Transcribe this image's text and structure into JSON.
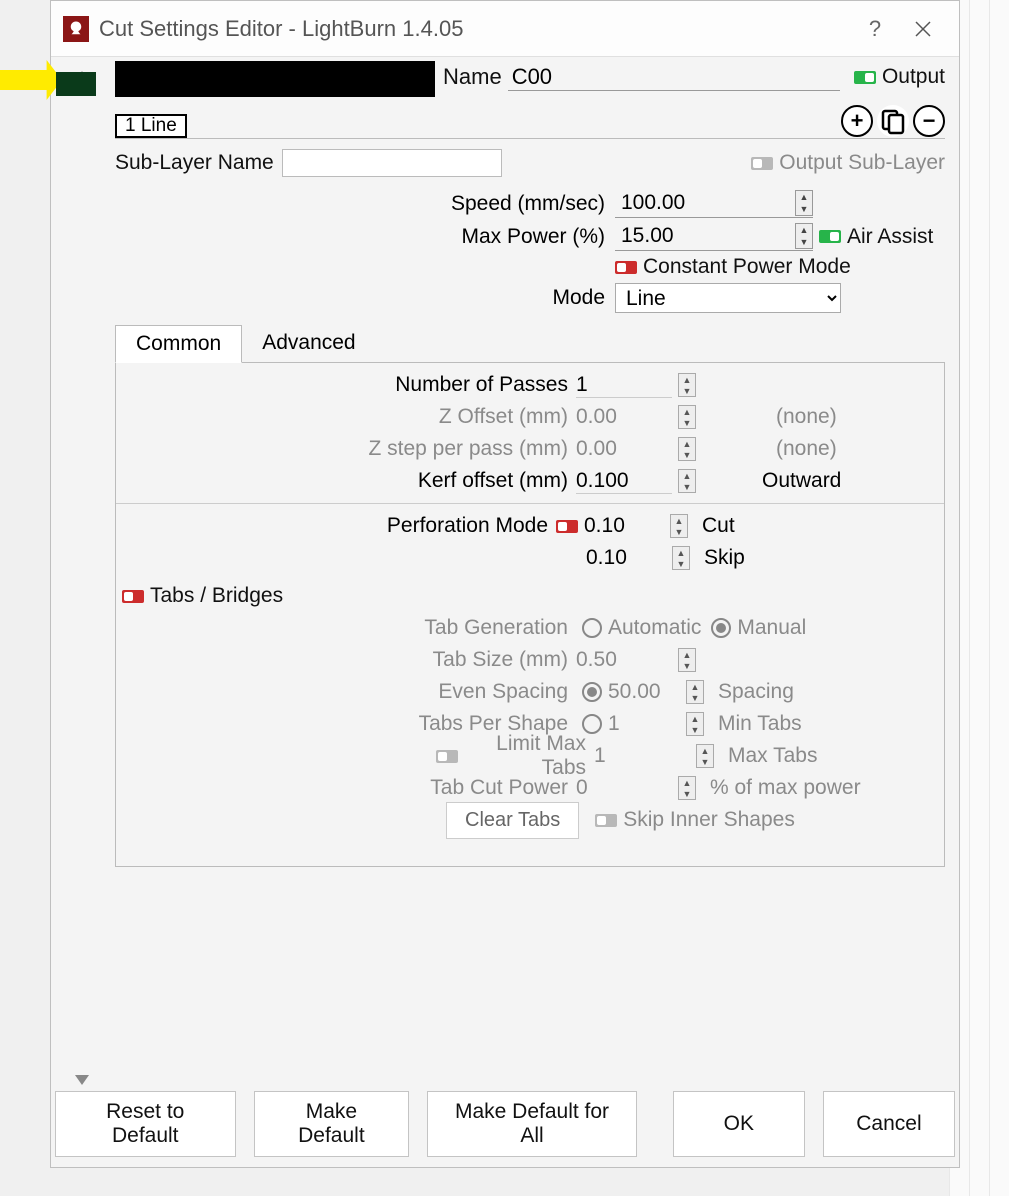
{
  "title": "Cut Settings Editor - LightBurn 1.4.05",
  "name_label": "Name",
  "name_value": "C00",
  "output_label": "Output",
  "tab1_label": "1 Line",
  "sublayer_label": "Sub-Layer Name",
  "sublayer_value": "",
  "output_sublayer": "Output Sub-Layer",
  "speed_label": "Speed (mm/sec)",
  "speed_value": "100.00",
  "maxpower_label": "Max Power (%)",
  "maxpower_value": "15.00",
  "airassist_label": "Air Assist",
  "cpm_label": "Constant Power Mode",
  "mode_label": "Mode",
  "mode_value": "Line",
  "tab_common": "Common",
  "tab_advanced": "Advanced",
  "passes_label": "Number of Passes",
  "passes_value": "1",
  "zoff_label": "Z Offset (mm)",
  "zoff_value": "0.00",
  "zoff_after": "(none)",
  "zstep_label": "Z step per pass (mm)",
  "zstep_value": "0.00",
  "zstep_after": "(none)",
  "kerf_label": "Kerf offset (mm)",
  "kerf_value": "0.100",
  "kerf_after": "Outward",
  "perf_label": "Perforation Mode",
  "perf_cut_value": "0.10",
  "perf_cut_label": "Cut",
  "perf_skip_value": "0.10",
  "perf_skip_label": "Skip",
  "tabs_label": "Tabs / Bridges",
  "tabgen_label": "Tab Generation",
  "tabgen_auto": "Automatic",
  "tabgen_manual": "Manual",
  "tabsize_label": "Tab Size (mm)",
  "tabsize_value": "0.50",
  "evenspace_label": "Even Spacing",
  "evenspace_value": "50.00",
  "evenspace_after": "Spacing",
  "tps_label": "Tabs Per Shape",
  "tps_value": "1",
  "tps_after": "Min Tabs",
  "limitmax_label": "Limit Max Tabs",
  "limitmax_value": "1",
  "limitmax_after": "Max Tabs",
  "tabcut_label": "Tab Cut Power",
  "tabcut_value": "0",
  "tabcut_after": "% of max power",
  "cleartabs": "Clear Tabs",
  "skipinner": "Skip Inner Shapes",
  "btn_reset": "Reset to Default",
  "btn_makedef": "Make Default",
  "btn_makedefall": "Make Default for All",
  "btn_ok": "OK",
  "btn_cancel": "Cancel"
}
